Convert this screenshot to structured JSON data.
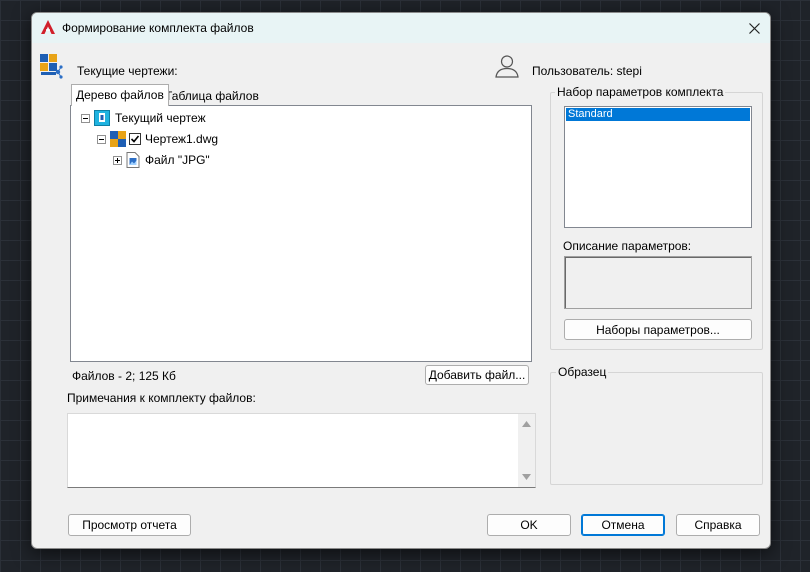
{
  "window": {
    "title": "Формирование комплекта файлов"
  },
  "left": {
    "current_drawings_label": "Текущие чертежи:",
    "tabs": [
      {
        "label": "Дерево файлов",
        "active": true
      },
      {
        "label": "Таблица файлов",
        "active": false
      }
    ],
    "tree": {
      "root": {
        "label": "Текущий чертеж",
        "expanded": true
      },
      "drawing": {
        "label": "Чертеж1.dwg",
        "expanded": true,
        "checked": true
      },
      "file_group": {
        "label": "Файл \"JPG\"",
        "expanded": false
      }
    },
    "files_summary": "Файлов - 2; 125 Кб",
    "add_file_button": "Добавить файл...",
    "notes_label": "Примечания к комплекту файлов:",
    "notes_value": ""
  },
  "right": {
    "user_label": "Пользователь: stepi",
    "setup_group_title": "Набор параметров комплекта",
    "setups": [
      "Standard"
    ],
    "selected_setup": "Standard",
    "description_label": "Описание параметров:",
    "description_value": "",
    "setups_button": "Наборы параметров...",
    "preview_group_title": "Образец"
  },
  "footer": {
    "view_report_button": "Просмотр отчета",
    "ok_button": "OK",
    "cancel_button": "Отмена",
    "help_button": "Справка"
  },
  "icons": {
    "app": "autocad-logo-icon",
    "close": "close-icon",
    "etransmit": "etransmit-icon",
    "user": "user-icon",
    "current_drawing": "current-drawing-icon",
    "dwg": "dwg-file-icon",
    "image_file": "image-file-icon"
  },
  "colors": {
    "accent": "#0078d7",
    "brand": "#d11f2a",
    "titlebar": "#e8f4f5"
  }
}
